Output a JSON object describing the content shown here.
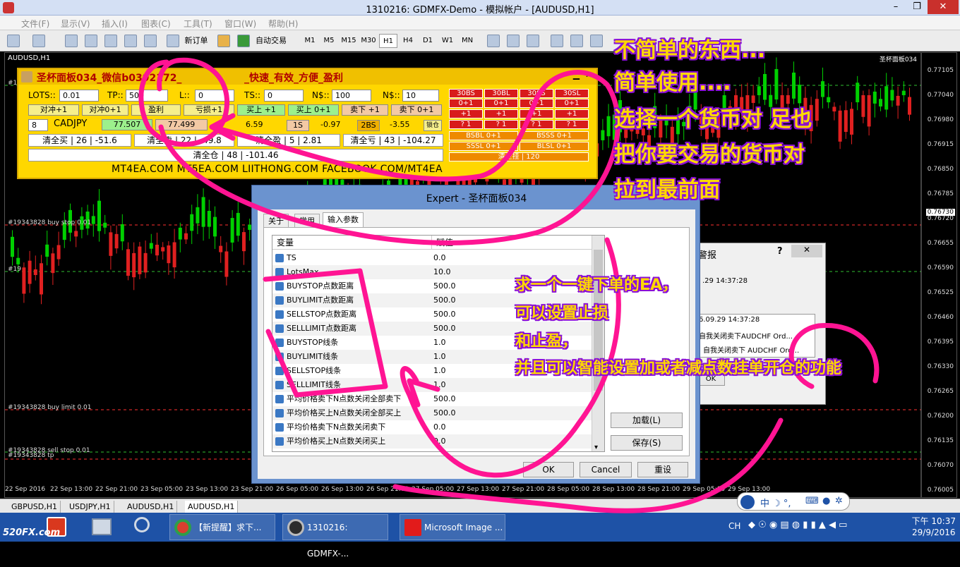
{
  "window": {
    "title": "1310216: GDMFX-Demo - 模拟帐户 - [AUDUSD,H1]",
    "min": "–",
    "restore": "❐",
    "close": "✕"
  },
  "menu": [
    "文件(F)",
    "显示(V)",
    "插入(I)",
    "图表(C)",
    "工具(T)",
    "窗口(W)",
    "帮助(H)"
  ],
  "toolbar": {
    "new_order": "新订单",
    "auto_trade": "自动交易",
    "timeframes": [
      "M1",
      "M5",
      "M15",
      "M30",
      "H1",
      "H4",
      "D1",
      "W1",
      "MN"
    ]
  },
  "chart": {
    "symbol": "AUDUSD,H1",
    "ea_label": "圣杯面板034",
    "prices": [
      "0.77105",
      "0.77040",
      "0.76980",
      "0.76915",
      "0.76850",
      "0.76785",
      "0.76720",
      "0.76655",
      "0.76590",
      "0.76525",
      "0.76460",
      "0.76395",
      "0.76330",
      "0.76265",
      "0.76200",
      "0.76135",
      "0.76070",
      "0.76005"
    ],
    "current_price": "0.76730",
    "times": [
      "22 Sep 2016",
      "22 Sep 13:00",
      "22 Sep 21:00",
      "23 Sep 05:00",
      "23 Sep 13:00",
      "23 Sep 21:00",
      "26 Sep 05:00",
      "26 Sep 13:00",
      "26 Sep 21:00",
      "27 Sep 05:00",
      "27 Sep 13:00",
      "27 Sep 21:00",
      "28 Sep 05:00",
      "28 Sep 13:00",
      "28 Sep 21:00",
      "29 Sep 05:00",
      "29 Sep 13:00"
    ],
    "order_labels": [
      "#19343828 buy stop 0.01",
      "#19343828 buy limit 0.01",
      "#19343828 sell stop 0.01",
      "#19343828 tp",
      "#1",
      "#19"
    ]
  },
  "panel": {
    "title": "圣杯面板034_微信b0392172_",
    "title_tail": "_快速_有效_方便_盈利",
    "lots_label": "LOTS::",
    "lots": "0.01",
    "tp_label": "TP::",
    "tp": "500",
    "sl_label": "L::",
    "sl": "0",
    "ts_label": "TS::",
    "ts": "0",
    "n_label": "N$::",
    "n": "100",
    "n2_label": "N$::",
    "n2": "10",
    "btn_row1": [
      "对冲+1",
      "对冲0+1",
      "盈利",
      "亏损+1",
      "买上 +1",
      "买上 0+1",
      "卖下 +1",
      "卖下 0+1"
    ],
    "qty": "8",
    "symbol": "CADJPY",
    "bid": "77.507",
    "ask": "77.499",
    "spread": "6.59",
    "one_s": "1S",
    "one_s_val": "-0.97",
    "two_bs": "2BS",
    "two_bs_val": "-3.55",
    "lock": "锁仓",
    "close_buy": "清全买 | 26 | -51.6",
    "close_sell": "清全卖 | 22 | -49.8",
    "close_profit": "清全盈 | 5 | 2.81",
    "close_loss": "清全亏 | 43 | -104.27",
    "close_all": "清全仓 | 48 | -101.46",
    "red_grid": [
      [
        "30BS",
        "30BL",
        "30SS",
        "30SL"
      ],
      [
        "0+1",
        "0+1",
        "0+1",
        "0+1"
      ],
      [
        "+1",
        "+1",
        "+1",
        "+1"
      ],
      [
        "?  1",
        "?  1",
        "?  1",
        "?  1"
      ]
    ],
    "orange": [
      "BSBL 0+1",
      "BSSS 0+1",
      "SSSL 0+1",
      "BLSL 0+1"
    ],
    "pending_all": "清全挂 | 120",
    "links": "MT4EA.COM    MT5EA.COM    LIITHONG.COM    FACEBOOK.COM/MT4EA"
  },
  "dialog": {
    "title": "Expert - 圣杯面板034",
    "tabs": [
      "关于",
      "常用",
      "输入参数"
    ],
    "col_var": "变量",
    "col_val": "赋值",
    "rows": [
      {
        "name": "TS",
        "value": "0.0"
      },
      {
        "name": "LotsMax",
        "value": "10.0"
      },
      {
        "name": "BUYSTOP点数距离",
        "value": "500.0"
      },
      {
        "name": "BUYLIMIT点数距离",
        "value": "500.0"
      },
      {
        "name": "SELLSTOP点数距离",
        "value": "500.0"
      },
      {
        "name": "SELLLIMIT点数距离",
        "value": "500.0"
      },
      {
        "name": "BUYSTOP线条",
        "value": "1.0"
      },
      {
        "name": "BUYLIMIT线条",
        "value": "1.0"
      },
      {
        "name": "SELLSTOP线条",
        "value": "1.0"
      },
      {
        "name": "SELLLIMIT线条",
        "value": "1.0"
      },
      {
        "name": "平均价格卖下N点数关闭全部卖下",
        "value": "500.0"
      },
      {
        "name": "平均价格买上N点数关闭全部买上",
        "value": "500.0"
      },
      {
        "name": "平均价格卖下N点数关闭卖下",
        "value": "0.0"
      },
      {
        "name": "平均价格买上N点数关闭买上",
        "value": "0.0"
      }
    ],
    "load": "加载(L)",
    "save": "保存(S)",
    "ok": "OK",
    "cancel": "Cancel",
    "reset": "重设"
  },
  "alert": {
    "title": "警报",
    "help": "?",
    "time1": ".29 14:37:28",
    "time2": "6.09.29 14:37:28",
    "msg1": "自我关闭卖下AUDCHF Ord...",
    "msg2": "自我关闭卖下 AUDCHF Ord...",
    "ok": "OK"
  },
  "symbol_tabs": [
    "GBPUSD,H1",
    "USDJPY,H1",
    "AUDUSD,H1",
    "AUDUSD,H1"
  ],
  "annotations": {
    "top": [
      "不简单的东西...",
      "简单使用....",
      "选择一个货币对 足也",
      "把你要交易的货币对",
      "拉到最前面"
    ],
    "middle": [
      "求一个一键下单的EA，",
      "可以设置止损",
      "和止盈，",
      "并且可以智能设置加或者减点数挂单开仓的功能"
    ]
  },
  "taskbar": {
    "items": [
      "【新提醒】求下...",
      "1310216: GDMFX-...",
      "Microsoft Image ..."
    ],
    "lang": "CH",
    "time": "下午 10:37",
    "date": "29/9/2016",
    "ime": "中 ☽ °,"
  },
  "watermark": "520FX.com",
  "colors": {
    "bull": "#00d000",
    "bear": "#e02020",
    "annotation": "#ffd800",
    "scribble": "#ff1493"
  }
}
